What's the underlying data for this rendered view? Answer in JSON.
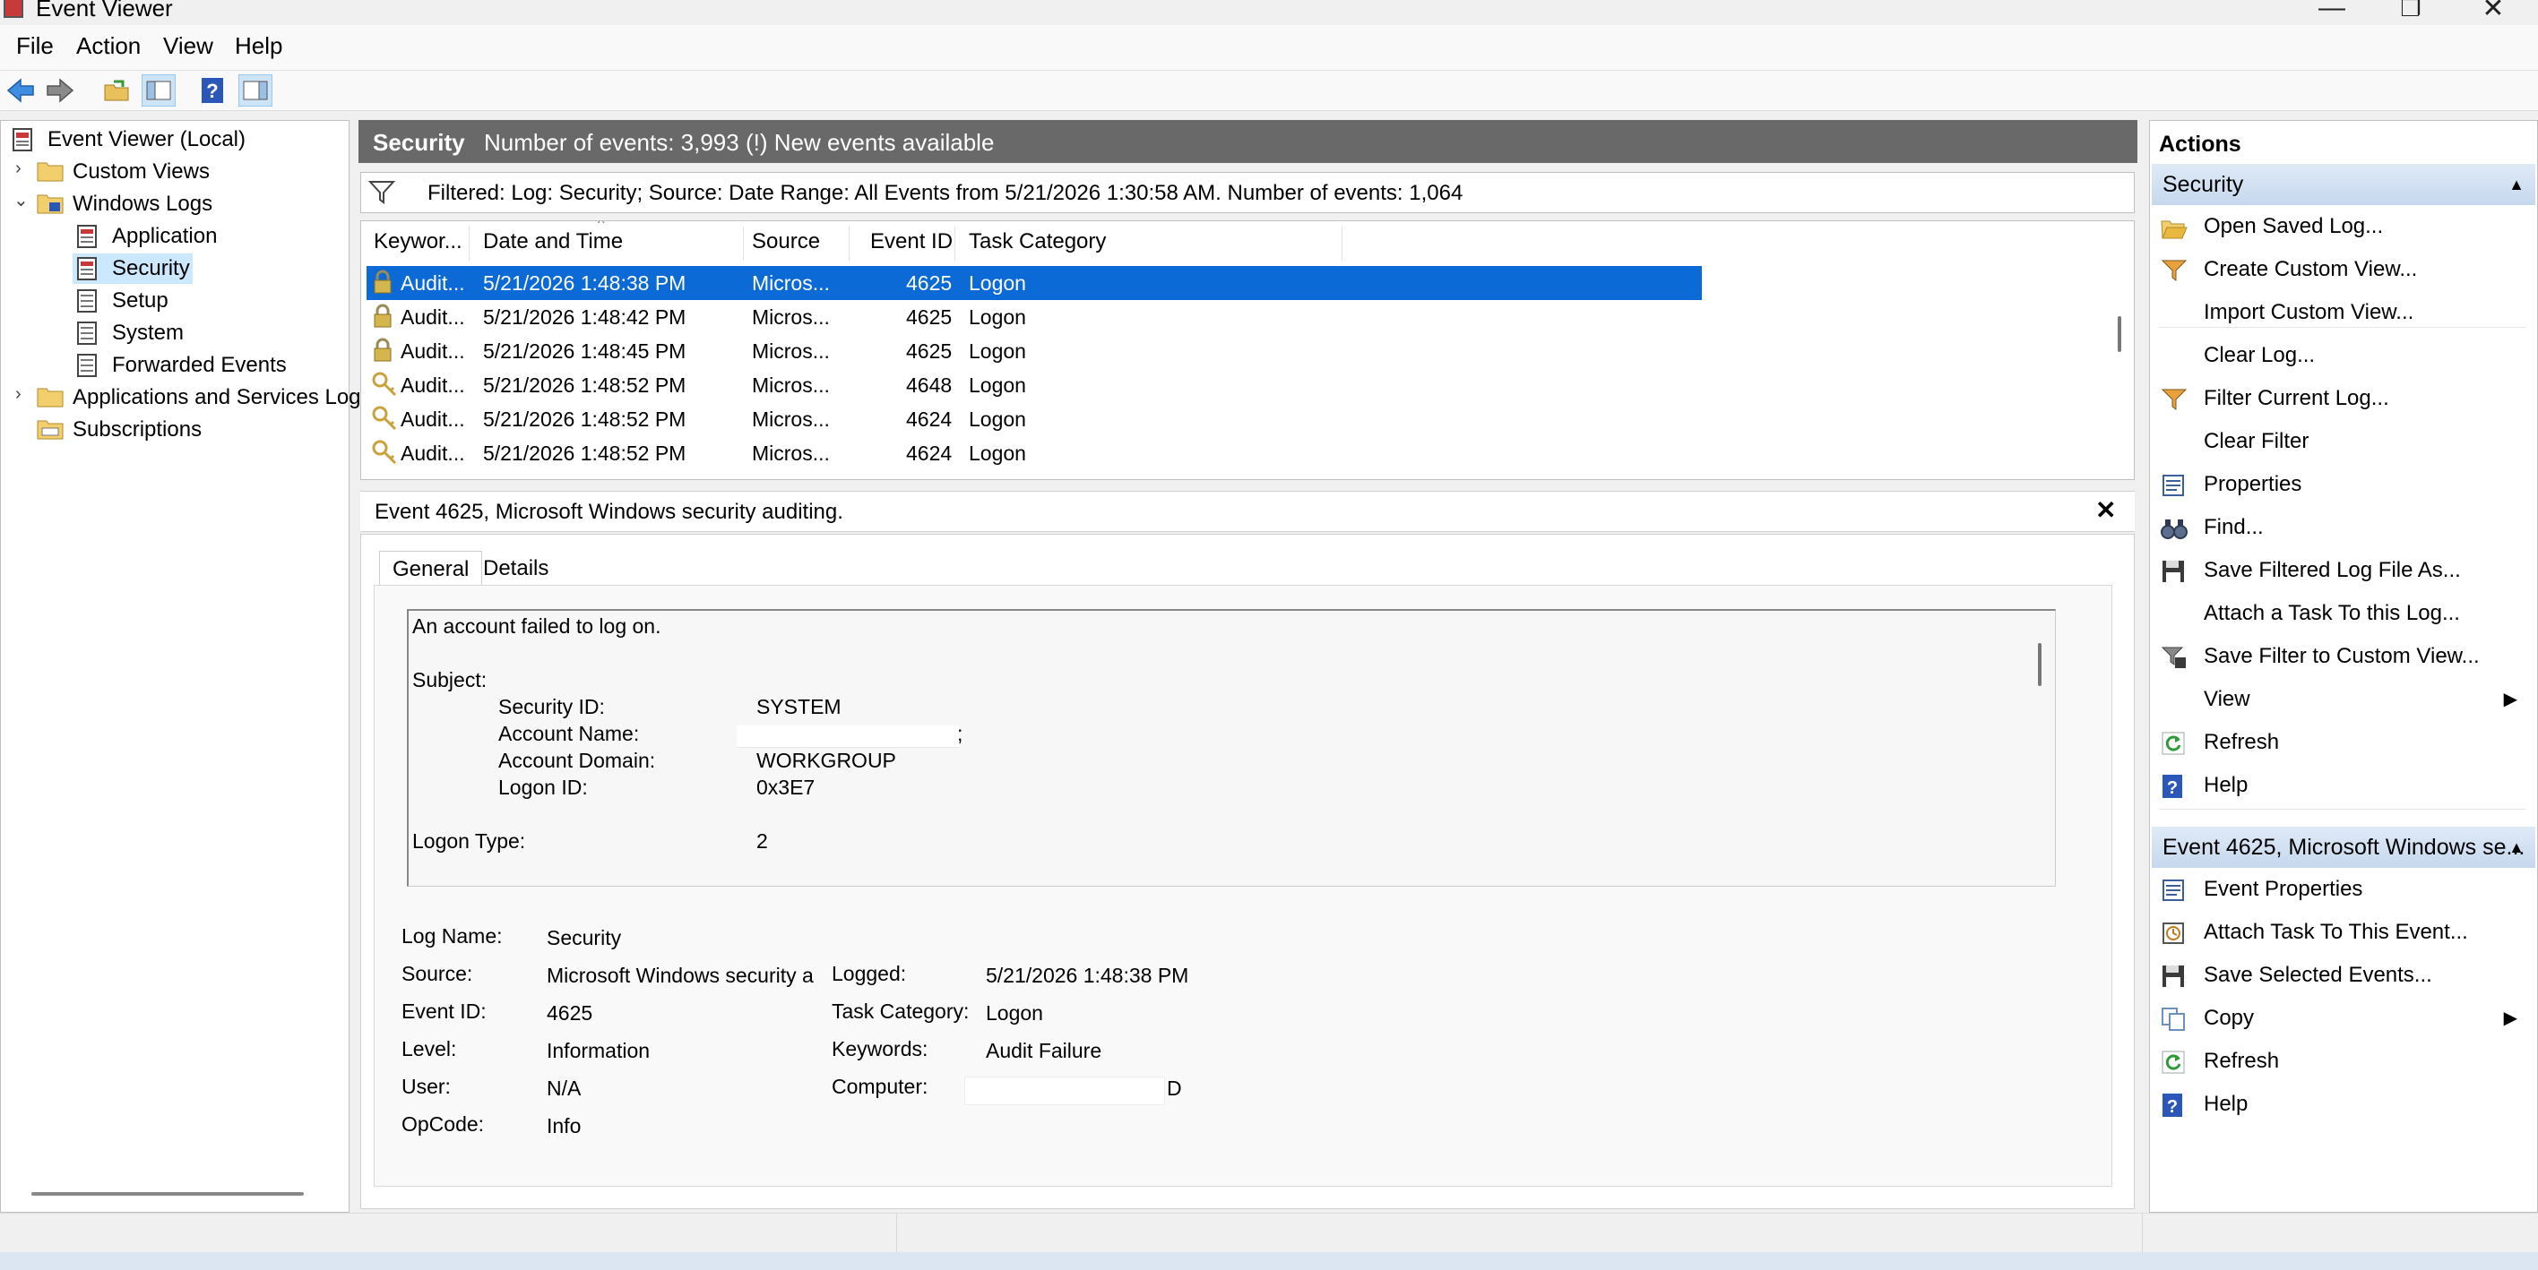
{
  "window": {
    "title": "Event Viewer",
    "controls": {
      "minimize": "—",
      "restore": "❐",
      "close": "✕"
    }
  },
  "menu": [
    "File",
    "Action",
    "View",
    "Help"
  ],
  "tree": {
    "root": "Event Viewer (Local)",
    "custom_views": "Custom Views",
    "windows_logs": "Windows Logs",
    "logs": [
      "Application",
      "Security",
      "Setup",
      "System",
      "Forwarded Events"
    ],
    "apps_services": "Applications and Services Log",
    "subscriptions": "Subscriptions",
    "selected": "Security"
  },
  "center": {
    "log_name": "Security",
    "event_count_text": "Number of events: 3,993 (!) New events available",
    "filter_text": "Filtered: Log: Security; Source: Date Range: All Events from 5/21/2026 1:30:58 AM. Number of events: 1,064",
    "columns": [
      "Keywor...",
      "Date and Time",
      "Source",
      "Event ID",
      "Task Category"
    ],
    "rows": [
      {
        "icon": "lock",
        "keyword": "Audit...",
        "datetime": "5/21/2026 1:48:38 PM",
        "source": "Micros...",
        "event_id": "4625",
        "category": "Logon",
        "selected": true
      },
      {
        "icon": "lock",
        "keyword": "Audit...",
        "datetime": "5/21/2026 1:48:42 PM",
        "source": "Micros...",
        "event_id": "4625",
        "category": "Logon"
      },
      {
        "icon": "lock",
        "keyword": "Audit...",
        "datetime": "5/21/2026 1:48:45 PM",
        "source": "Micros...",
        "event_id": "4625",
        "category": "Logon"
      },
      {
        "icon": "key",
        "keyword": "Audit...",
        "datetime": "5/21/2026 1:48:52 PM",
        "source": "Micros...",
        "event_id": "4648",
        "category": "Logon"
      },
      {
        "icon": "key",
        "keyword": "Audit...",
        "datetime": "5/21/2026 1:48:52 PM",
        "source": "Micros...",
        "event_id": "4624",
        "category": "Logon"
      },
      {
        "icon": "key",
        "keyword": "Audit...",
        "datetime": "5/21/2026 1:48:52 PM",
        "source": "Micros...",
        "event_id": "4624",
        "category": "Logon"
      }
    ]
  },
  "detail": {
    "title": "Event 4625, Microsoft Windows security auditing.",
    "close": "✕",
    "tabs": [
      "General",
      "Details"
    ],
    "description": {
      "line1": "An account failed to log on.",
      "subject_label": "Subject:",
      "security_id_label": "Security ID:",
      "security_id": "SYSTEM",
      "account_name_label": "Account Name:",
      "account_name_tail": ";",
      "account_domain_label": "Account Domain:",
      "account_domain": "WORKGROUP",
      "logon_id_label": "Logon ID:",
      "logon_id": "0x3E7",
      "logon_type_label": "Logon Type:",
      "logon_type": "2"
    },
    "fields": {
      "log_name_label": "Log Name:",
      "log_name": "Security",
      "source_label": "Source:",
      "source": "Microsoft Windows security a",
      "event_id_label": "Event ID:",
      "event_id": "4625",
      "level_label": "Level:",
      "level": "Information",
      "user_label": "User:",
      "user": "N/A",
      "opcode_label": "OpCode:",
      "opcode": "Info",
      "logged_label": "Logged:",
      "logged": "5/21/2026 1:48:38 PM",
      "task_category_label": "Task Category:",
      "task_category": "Logon",
      "keywords_label": "Keywords:",
      "keywords": "Audit Failure",
      "computer_label": "Computer:",
      "computer_tail": "D"
    }
  },
  "actions": {
    "title": "Actions",
    "section1": "Security",
    "items1": [
      {
        "icon": "folder-open-icon",
        "label": "Open Saved Log..."
      },
      {
        "icon": "filter-icon",
        "label": "Create Custom View..."
      },
      {
        "icon": "",
        "label": "Import Custom View..."
      },
      {
        "icon": "",
        "label": "Clear Log..."
      },
      {
        "icon": "filter-icon",
        "label": "Filter Current Log..."
      },
      {
        "icon": "",
        "label": "Clear Filter"
      },
      {
        "icon": "properties-icon",
        "label": "Properties"
      },
      {
        "icon": "binoculars-icon",
        "label": "Find..."
      },
      {
        "icon": "save-icon",
        "label": "Save Filtered Log File As..."
      },
      {
        "icon": "",
        "label": "Attach a Task To this Log..."
      },
      {
        "icon": "filter-save-icon",
        "label": "Save Filter to Custom View..."
      },
      {
        "icon": "",
        "label": "View",
        "submenu": "▶"
      },
      {
        "icon": "refresh-icon",
        "label": "Refresh"
      },
      {
        "icon": "help-icon",
        "label": "Help"
      }
    ],
    "section2": "Event 4625, Microsoft Windows se...",
    "items2": [
      {
        "icon": "properties-icon",
        "label": "Event Properties"
      },
      {
        "icon": "task-icon",
        "label": "Attach Task To This Event..."
      },
      {
        "icon": "save-icon",
        "label": "Save Selected Events..."
      },
      {
        "icon": "copy-icon",
        "label": "Copy",
        "submenu": "▶"
      },
      {
        "icon": "refresh-icon",
        "label": "Refresh"
      },
      {
        "icon": "help-icon",
        "label": "Help"
      }
    ]
  },
  "colors": {
    "selection": "#0b6ad5",
    "tree_selection": "#cce8ff",
    "header_bg": "#696969",
    "action_section_bg": "#c6d8ee"
  }
}
